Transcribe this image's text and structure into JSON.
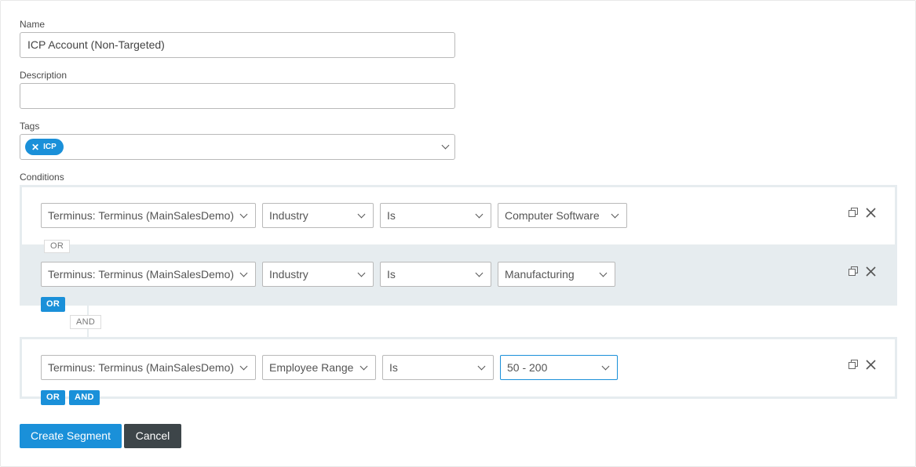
{
  "form": {
    "name_label": "Name",
    "name_value": "ICP Account (Non-Targeted)",
    "description_label": "Description",
    "description_value": "",
    "tags_label": "Tags",
    "tags": [
      "ICP"
    ],
    "conditions_label": "Conditions"
  },
  "groups": [
    {
      "rows": [
        {
          "source": "Terminus: Terminus (MainSalesDemo)",
          "field": "Industry",
          "operator": "Is",
          "value": "Computer Software"
        },
        {
          "source": "Terminus: Terminus (MainSalesDemo)",
          "field": "Industry",
          "operator": "Is",
          "value": "Manufacturing"
        }
      ],
      "row_joiner": "OR",
      "actions": [
        "OR"
      ]
    },
    {
      "rows": [
        {
          "source": "Terminus: Terminus (MainSalesDemo)",
          "field": "Employee Range",
          "operator": "Is",
          "value": "50 - 200"
        }
      ],
      "actions": [
        "OR",
        "AND"
      ]
    }
  ],
  "group_joiner": "AND",
  "buttons": {
    "create": "Create Segment",
    "cancel": "Cancel"
  },
  "icons": [
    "duplicate-icon",
    "close-icon",
    "chevron-down-icon",
    "tag-remove-icon"
  ],
  "colors": {
    "accent": "#1a90d9",
    "dark_button": "#3d4549",
    "group_border": "#e6ecef"
  }
}
